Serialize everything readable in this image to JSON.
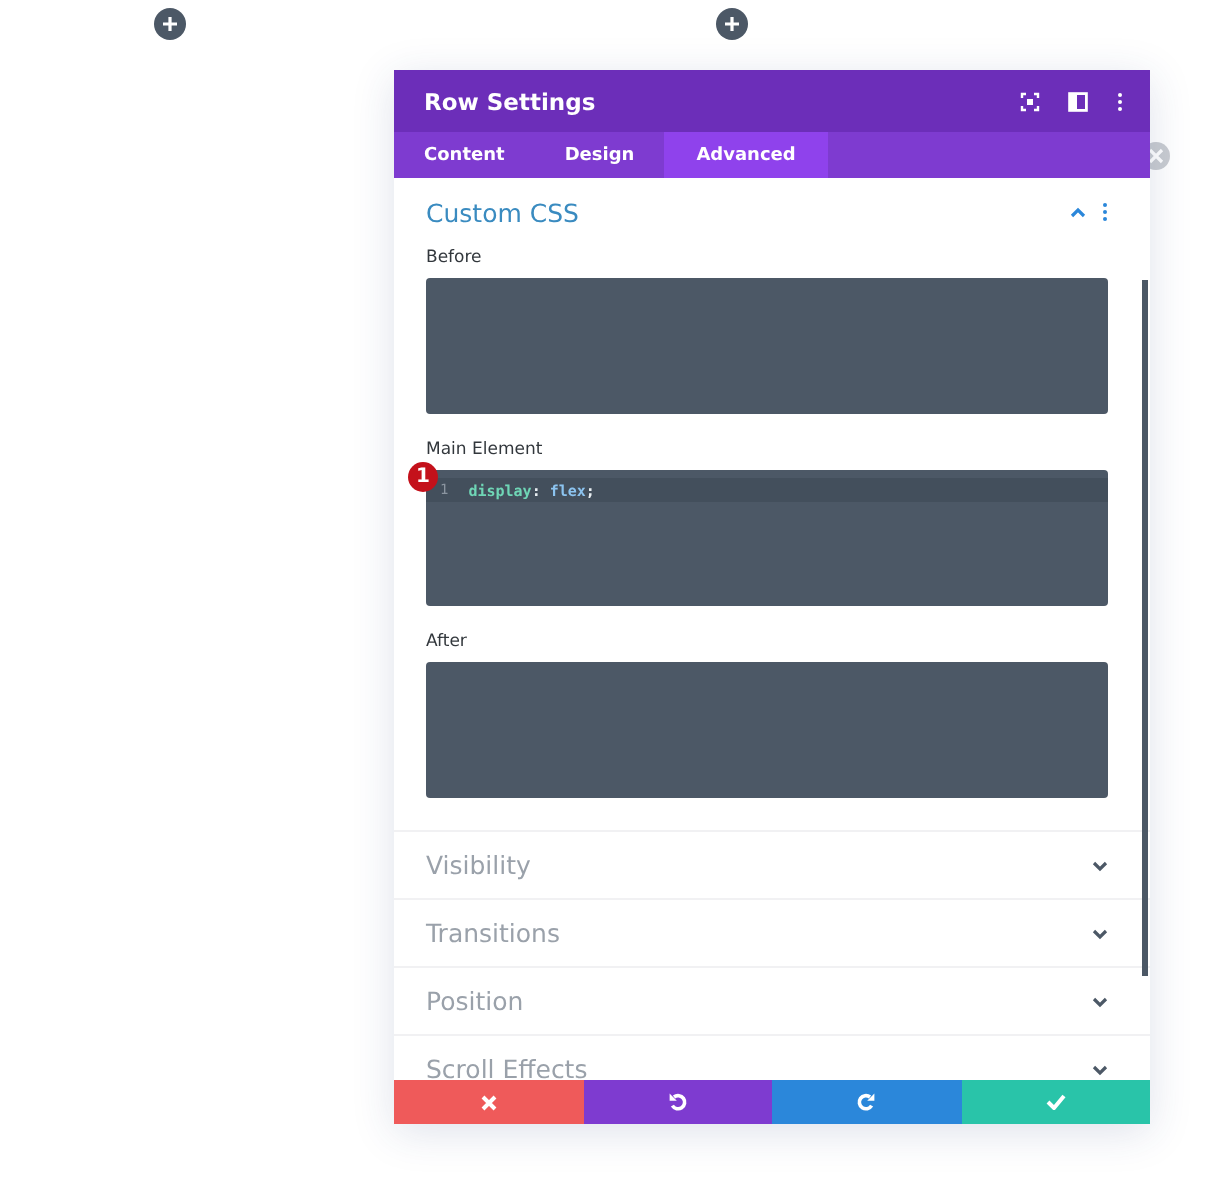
{
  "window": {
    "title": "Row Settings"
  },
  "tabs": [
    {
      "label": "Content",
      "selected": false
    },
    {
      "label": "Design",
      "selected": false
    },
    {
      "label": "Advanced",
      "selected": true
    }
  ],
  "sections": [
    {
      "title": "Custom CSS",
      "expanded": true,
      "fields": [
        {
          "label": "Before"
        },
        {
          "label": "Main Element",
          "badge": "1",
          "lines": [
            {
              "number": "1",
              "tokens": [
                {
                  "text": "display",
                  "kind": "property"
                },
                {
                  "text": ":",
                  "kind": "punct"
                },
                {
                  "text": " flex",
                  "kind": "value"
                },
                {
                  "text": ";",
                  "kind": "punct"
                }
              ]
            }
          ]
        },
        {
          "label": "After"
        }
      ]
    },
    {
      "title": "Visibility",
      "expanded": false
    },
    {
      "title": "Transitions",
      "expanded": false
    },
    {
      "title": "Position",
      "expanded": false
    },
    {
      "title": "Scroll Effects",
      "expanded": false
    }
  ],
  "footer_buttons": [
    {
      "kind": "cancel",
      "color": "#ef5a5a"
    },
    {
      "kind": "undo",
      "color": "#7e3bd0"
    },
    {
      "kind": "redo",
      "color": "#2b87da"
    },
    {
      "kind": "save",
      "color": "#29c4a9"
    }
  ]
}
